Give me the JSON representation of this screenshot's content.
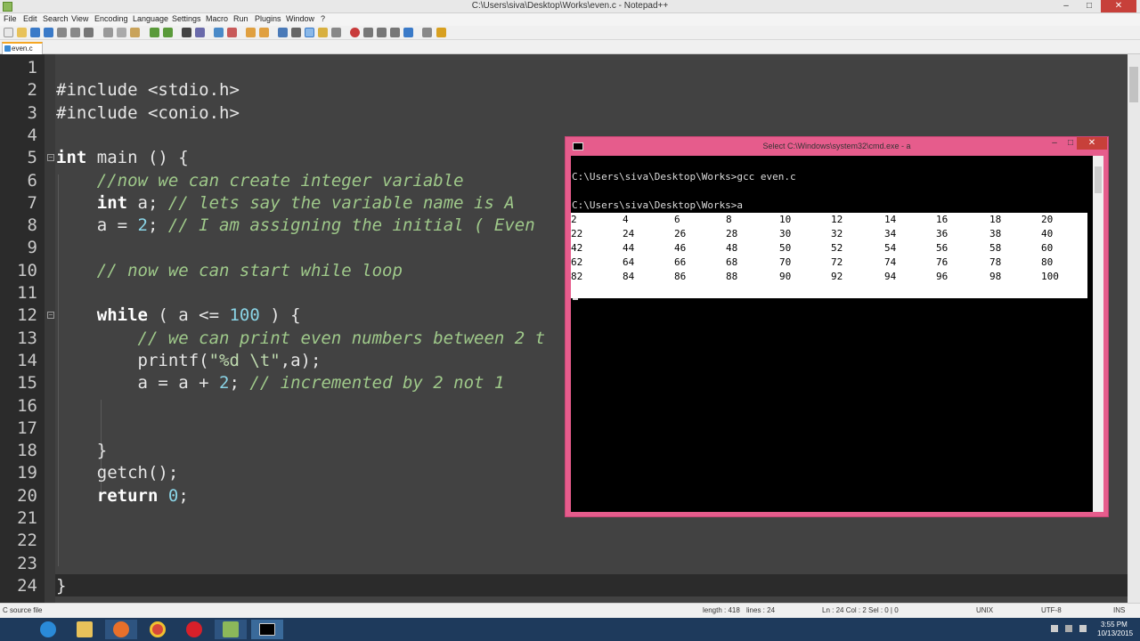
{
  "window": {
    "title": "C:\\Users\\siva\\Desktop\\Works\\even.c - Notepad++",
    "minimize": "–",
    "maximize": "□",
    "close": "✕"
  },
  "menu": [
    "File",
    "Edit",
    "Search",
    "View",
    "Encoding",
    "Language",
    "Settings",
    "Macro",
    "Run",
    "Plugins",
    "Window",
    "?"
  ],
  "tab": {
    "label": "even.c"
  },
  "editor": {
    "lines": [
      {
        "n": "1",
        "html": ""
      },
      {
        "n": "2",
        "html": "#include &lt;stdio.h&gt;"
      },
      {
        "n": "3",
        "html": "#include &lt;conio.h&gt;"
      },
      {
        "n": "4",
        "html": ""
      },
      {
        "n": "5",
        "html": "<span class='kw'>int</span> main () {"
      },
      {
        "n": "6",
        "html": "    <span class='cm'>//now we can create integer variable</span>"
      },
      {
        "n": "7",
        "html": "    <span class='kw'>int</span> a; <span class='cm'>// lets say the variable name is A</span>"
      },
      {
        "n": "8",
        "html": "    a = <span class='num'>2</span>; <span class='cm'>// I am assigning the initial ( Even</span>"
      },
      {
        "n": "9",
        "html": ""
      },
      {
        "n": "10",
        "html": "    <span class='cm'>// now we can start while loop</span>"
      },
      {
        "n": "11",
        "html": ""
      },
      {
        "n": "12",
        "html": "    <span class='kw'>while</span> ( a &lt;= <span class='num'>100</span> ) {"
      },
      {
        "n": "13",
        "html": "        <span class='cm'>// we can print even numbers between 2 t</span>"
      },
      {
        "n": "14",
        "html": "        printf(<span class='str'>\"%d \\t\"</span>,a);"
      },
      {
        "n": "15",
        "html": "        a = a + <span class='num'>2</span>; <span class='cm'>// incremented by 2 not 1</span>"
      },
      {
        "n": "16",
        "html": ""
      },
      {
        "n": "17",
        "html": ""
      },
      {
        "n": "18",
        "html": "    }"
      },
      {
        "n": "19",
        "html": "    getch();"
      },
      {
        "n": "20",
        "html": "    <span class='kw'>return</span> <span class='num'>0</span>;"
      },
      {
        "n": "21",
        "html": ""
      },
      {
        "n": "22",
        "html": ""
      },
      {
        "n": "23",
        "html": ""
      },
      {
        "n": "24",
        "html": "}"
      }
    ]
  },
  "cmd": {
    "title": "Select C:\\Windows\\system32\\cmd.exe - a",
    "minimize": "–",
    "maximize": "□",
    "close": "✕",
    "line1": "C:\\Users\\siva\\Desktop\\Works>gcc even.c",
    "line2": "C:\\Users\\siva\\Desktop\\Works>a",
    "rows": [
      [
        "2",
        "4",
        "6",
        "8",
        "10",
        "12",
        "14",
        "16",
        "18",
        "20"
      ],
      [
        "22",
        "24",
        "26",
        "28",
        "30",
        "32",
        "34",
        "36",
        "38",
        "40"
      ],
      [
        "42",
        "44",
        "46",
        "48",
        "50",
        "52",
        "54",
        "56",
        "58",
        "60"
      ],
      [
        "62",
        "64",
        "66",
        "68",
        "70",
        "72",
        "74",
        "76",
        "78",
        "80"
      ],
      [
        "82",
        "84",
        "86",
        "88",
        "90",
        "92",
        "94",
        "96",
        "98",
        "100"
      ]
    ]
  },
  "status": {
    "type": "C source file",
    "length": "length : 418",
    "lines": "lines : 24",
    "pos": "Ln : 24   Col : 2   Sel : 0 | 0",
    "eol": "UNIX",
    "encoding": "UTF-8",
    "ins": "INS"
  },
  "taskbar": {
    "time": "3:55 PM",
    "date": "10/13/2015"
  }
}
